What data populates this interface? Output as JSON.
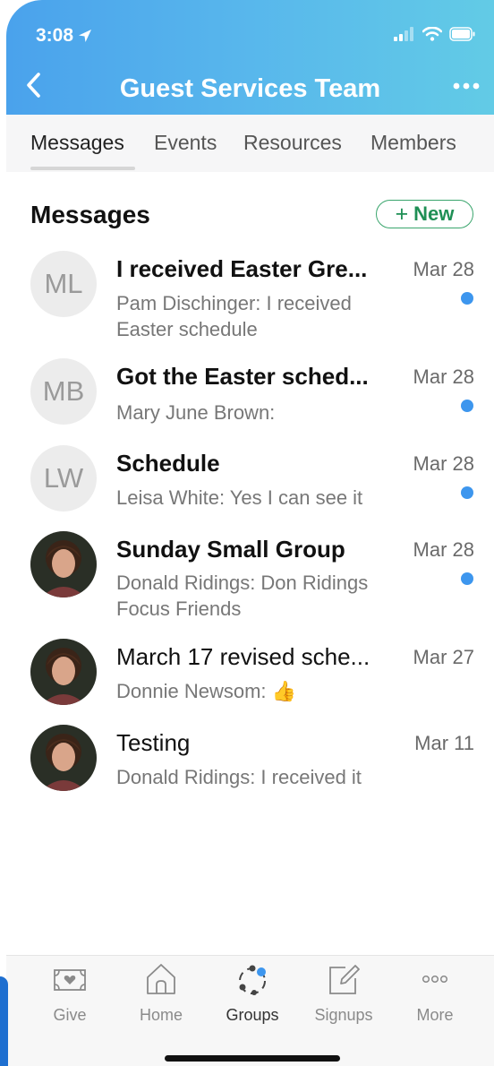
{
  "status": {
    "time": "3:08",
    "location_icon": "location-arrow-icon",
    "icons": [
      "cellular-signal-icon",
      "wifi-icon",
      "battery-icon"
    ]
  },
  "header": {
    "title": "Guest Services Team",
    "back_icon": "chevron-left-icon",
    "more_icon": "ellipsis-icon",
    "gradient": [
      "#4aa2ec",
      "#62cbe6"
    ]
  },
  "tabs": [
    {
      "label": "Messages",
      "active": true
    },
    {
      "label": "Events",
      "active": false
    },
    {
      "label": "Resources",
      "active": false
    },
    {
      "label": "Members",
      "active": false
    }
  ],
  "section": {
    "title": "Messages",
    "new_label": "New",
    "new_plus": "+",
    "accent": "#3aa56d"
  },
  "messages": [
    {
      "initials": "ML",
      "title": "I received Easter Gre...",
      "date": "Mar 28",
      "preview": "Pam Dischinger: I received Easter schedule",
      "unread": true
    },
    {
      "initials": "MB",
      "title": "Got the Easter sched...",
      "date": "Mar 28",
      "preview": "Mary June Brown:",
      "unread": true
    },
    {
      "initials": "LW",
      "title": "Schedule",
      "date": "Mar 28",
      "preview": "Leisa White: Yes I can see it",
      "unread": true
    },
    {
      "initials": "",
      "title": "Sunday Small Group",
      "date": "Mar 28",
      "preview": "Donald Ridings: Don Ridings Focus Friends",
      "unread": true
    },
    {
      "initials": "",
      "title": "March 17 revised sche...",
      "date": "Mar 27",
      "preview": "Donnie Newsom: 👍",
      "unread": false
    },
    {
      "initials": "",
      "title": "Testing",
      "date": "Mar 11",
      "preview": "Donald Ridings: I received it",
      "unread": false
    }
  ],
  "unread_color": "#3d96ee",
  "tabbar": [
    {
      "label": "Give",
      "icon": "give-icon",
      "active": false
    },
    {
      "label": "Home",
      "icon": "home-icon",
      "active": false
    },
    {
      "label": "Groups",
      "icon": "groups-icon",
      "active": true
    },
    {
      "label": "Signups",
      "icon": "signups-icon",
      "active": false
    },
    {
      "label": "More",
      "icon": "more-icon",
      "active": false
    }
  ]
}
